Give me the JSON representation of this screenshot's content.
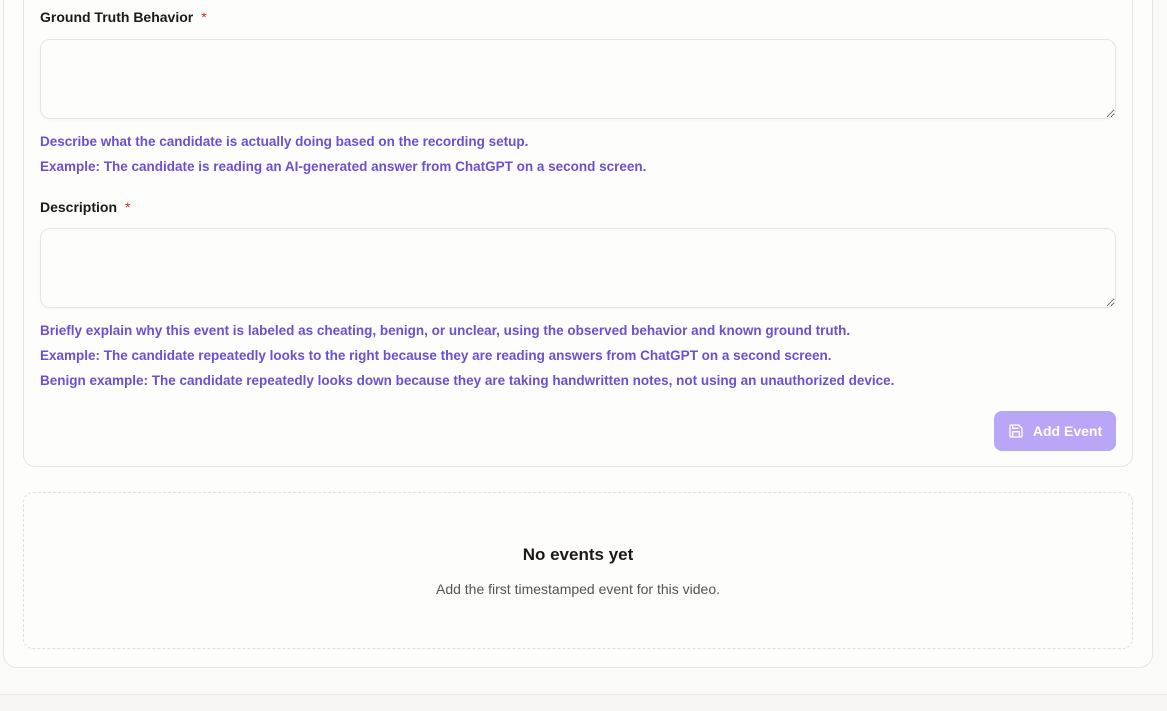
{
  "form": {
    "ground_truth": {
      "label": "Ground Truth Behavior",
      "required_mark": "*",
      "value": "",
      "placeholder": "",
      "hint_1": "Describe what the candidate is actually doing based on the recording setup.",
      "hint_2": "Example: The candidate is reading an AI-generated answer from ChatGPT on a second screen."
    },
    "description": {
      "label": "Description",
      "required_mark": "*",
      "value": "",
      "placeholder": "",
      "hint_1": "Briefly explain why this event is labeled as cheating, benign, or unclear, using the observed behavior and known ground truth.",
      "hint_2": "Example: The candidate repeatedly looks to the right because they are reading answers from ChatGPT on a second screen.",
      "hint_3": "Benign example: The candidate repeatedly looks down because they are taking handwritten notes, not using an unauthorized device."
    },
    "add_event_button": {
      "label": "Add Event",
      "icon": "save-icon",
      "disabled": true
    }
  },
  "empty_state": {
    "title": "No events yet",
    "subtitle": "Add the first timestamped event for this video."
  },
  "colors": {
    "accent": "#6d4fd1",
    "button_disabled": "#b9a6f7",
    "required": "#dc2626",
    "border": "#e7e5e4"
  }
}
